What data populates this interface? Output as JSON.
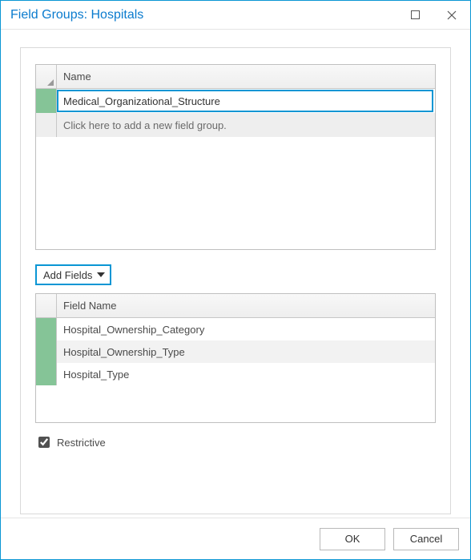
{
  "window": {
    "title": "Field Groups: Hospitals"
  },
  "groups_grid": {
    "header": {
      "name": "Name"
    },
    "rows": [
      {
        "name": "Medical_Organizational_Structure"
      }
    ],
    "placeholder": "Click here to add a new field group."
  },
  "add_fields": {
    "label": "Add Fields"
  },
  "fields_grid": {
    "header": {
      "field_name": "Field Name"
    },
    "rows": [
      {
        "name": "Hospital_Ownership_Category"
      },
      {
        "name": "Hospital_Ownership_Type"
      },
      {
        "name": "Hospital_Type"
      }
    ]
  },
  "restrictive": {
    "label": "Restrictive",
    "checked": true
  },
  "footer": {
    "ok": "OK",
    "cancel": "Cancel"
  }
}
